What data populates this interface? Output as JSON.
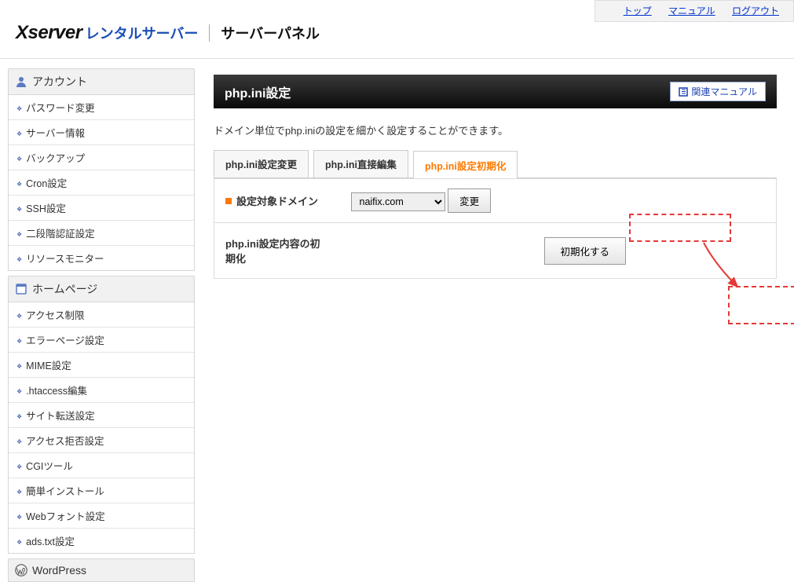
{
  "topLinks": {
    "top": "トップ",
    "manual": "マニュアル",
    "logout": "ログアウト"
  },
  "brand": {
    "x": "Xserver",
    "rental": "レンタルサーバー",
    "panel": "サーバーパネル"
  },
  "sidebar": {
    "sections": [
      {
        "title": "アカウント",
        "icon": "user",
        "items": [
          "パスワード変更",
          "サーバー情報",
          "バックアップ",
          "Cron設定",
          "SSH設定",
          "二段階認証設定",
          "リソースモニター"
        ]
      },
      {
        "title": "ホームページ",
        "icon": "page",
        "items": [
          "アクセス制限",
          "エラーページ設定",
          "MIME設定",
          ".htaccess編集",
          "サイト転送設定",
          "アクセス拒否設定",
          "CGIツール",
          "簡単インストール",
          "Webフォント設定",
          "ads.txt設定"
        ]
      },
      {
        "title": "WordPress",
        "icon": "wordpress",
        "items": []
      }
    ]
  },
  "main": {
    "title": "php.ini設定",
    "manualBtn": "関連マニュアル",
    "description": "ドメイン単位でphp.iniの設定を細かく設定することができます。",
    "tabs": [
      "php.ini設定変更",
      "php.ini直接編集",
      "php.ini設定初期化"
    ],
    "activeTab": 2,
    "domainLabel": "設定対象ドメイン",
    "domainValue": "naifix.com",
    "changeBtn": "変更",
    "resetLabel": "php.ini設定内容の初期化",
    "resetBtn": "初期化する"
  }
}
